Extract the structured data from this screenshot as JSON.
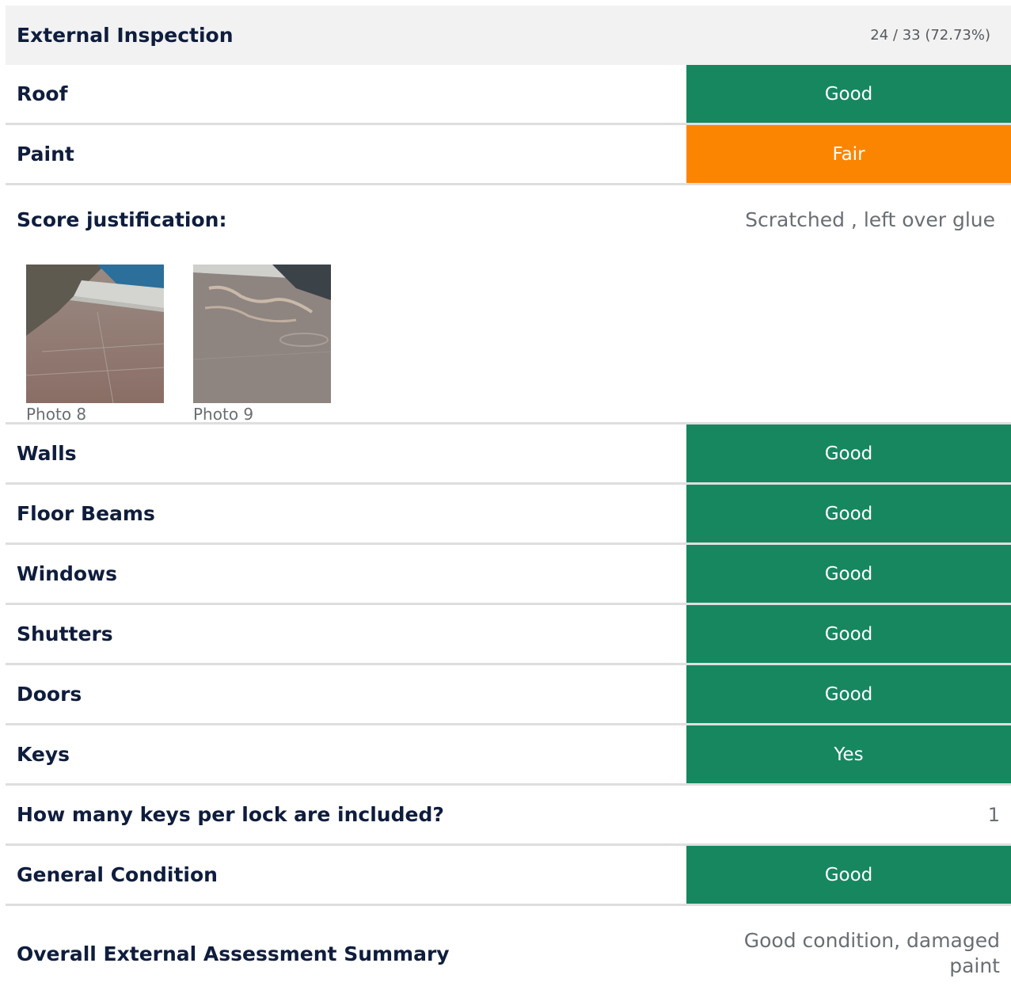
{
  "section": {
    "title": "External Inspection",
    "score": "24 / 33 (72.73%)"
  },
  "rows": {
    "roof": {
      "label": "Roof",
      "value": "Good",
      "status_color": "#178760"
    },
    "paint": {
      "label": "Paint",
      "value": "Fair",
      "status_color": "#fb8500"
    },
    "walls": {
      "label": "Walls",
      "value": "Good",
      "status_color": "#178760"
    },
    "floor_beams": {
      "label": "Floor Beams",
      "value": "Good",
      "status_color": "#178760"
    },
    "windows": {
      "label": "Windows",
      "value": "Good",
      "status_color": "#178760"
    },
    "shutters": {
      "label": "Shutters",
      "value": "Good",
      "status_color": "#178760"
    },
    "doors": {
      "label": "Doors",
      "value": "Good",
      "status_color": "#178760"
    },
    "keys": {
      "label": "Keys",
      "value": "Yes",
      "status_color": "#178760"
    },
    "keys_per_lock": {
      "label": "How many keys per lock are included?",
      "value": "1"
    },
    "general_condition": {
      "label": "General Condition",
      "value": "Good",
      "status_color": "#178760"
    }
  },
  "justification": {
    "label": "Score justification:",
    "text": "Scratched , left over glue",
    "photos": [
      {
        "caption": "Photo 8"
      },
      {
        "caption": "Photo 9"
      }
    ]
  },
  "summary": {
    "label": "Overall External Assessment Summary",
    "text": "Good condition, damaged paint"
  }
}
